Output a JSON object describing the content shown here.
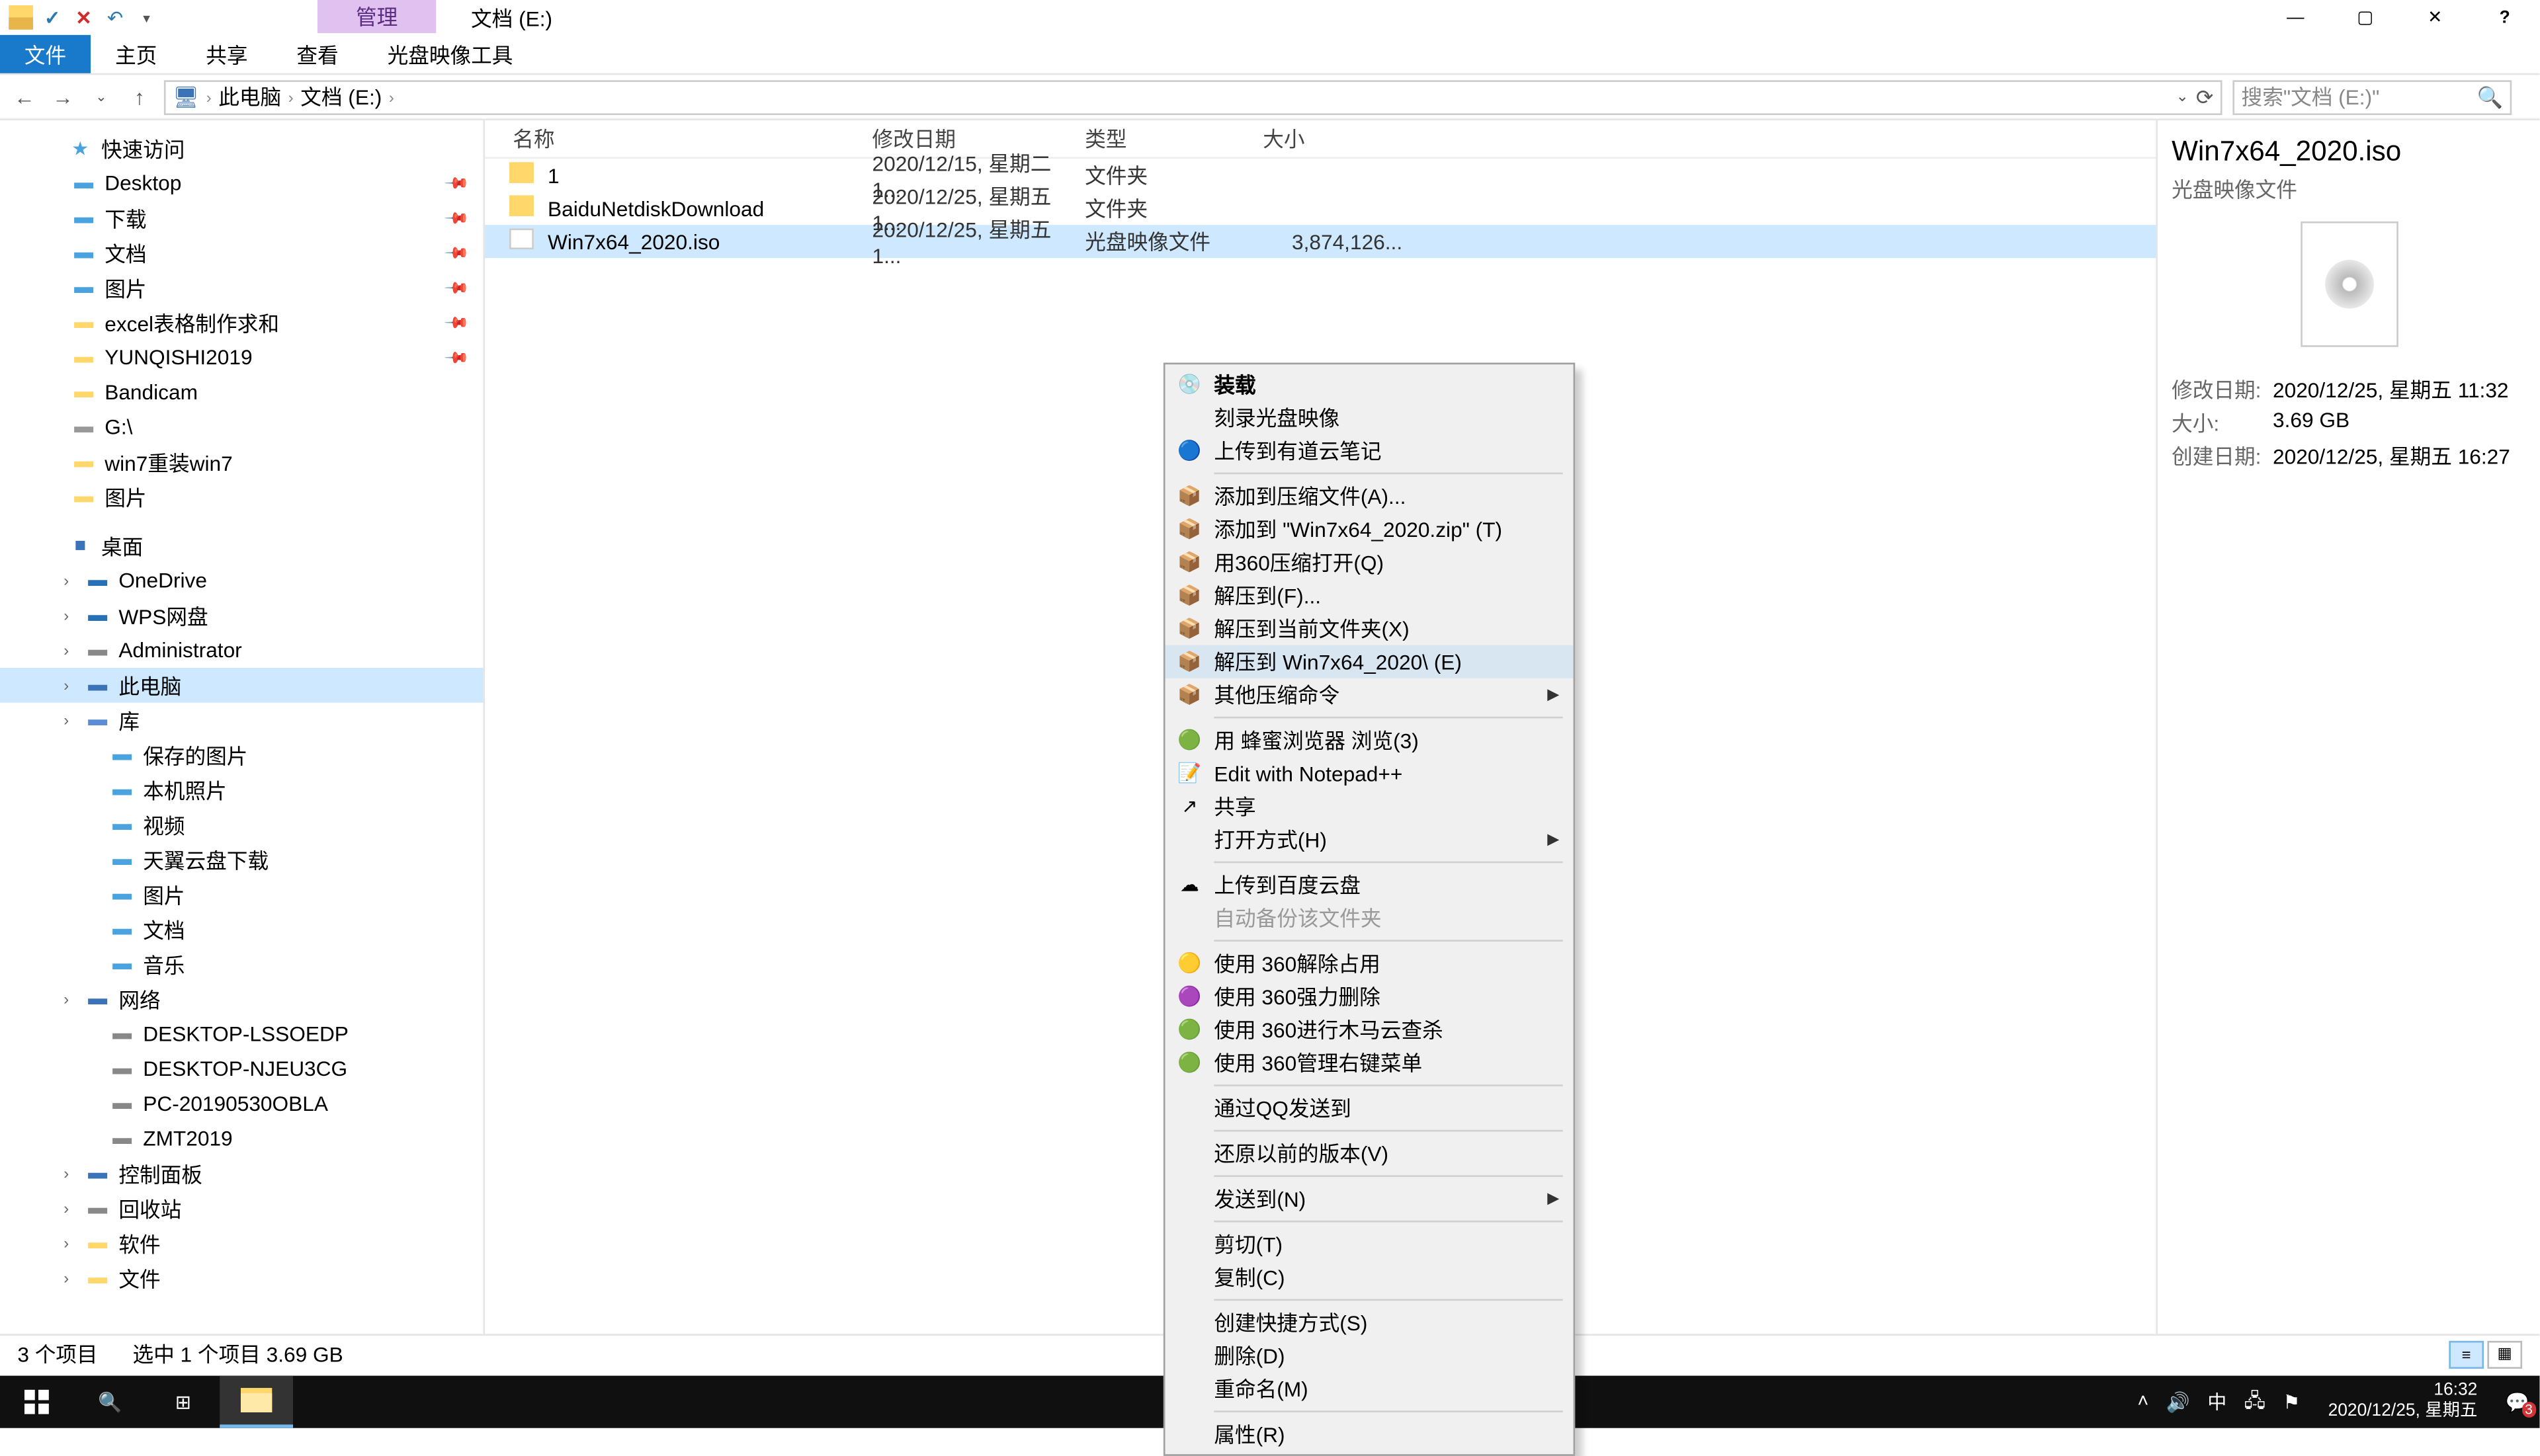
{
  "window": {
    "title": "文档 (E:)",
    "contextual_tab": "管理",
    "ribbon_tabs": [
      "文件",
      "主页",
      "共享",
      "查看",
      "光盘映像工具"
    ],
    "active_tab": 0
  },
  "navbuttons": {
    "back": "←",
    "fwd": "→",
    "up": "↑"
  },
  "breadcrumb": [
    "此电脑",
    "文档 (E:)"
  ],
  "search": {
    "placeholder": "搜索\"文档 (E:)\""
  },
  "nav": {
    "quick": {
      "label": "快速访问",
      "items": [
        {
          "label": "Desktop",
          "pin": true,
          "color": "#4aa3df"
        },
        {
          "label": "下载",
          "pin": true,
          "color": "#4aa3df"
        },
        {
          "label": "文档",
          "pin": true,
          "color": "#4aa3df"
        },
        {
          "label": "图片",
          "pin": true,
          "color": "#4aa3df"
        },
        {
          "label": "excel表格制作求和",
          "pin": true,
          "color": "#ffd76a"
        },
        {
          "label": "YUNQISHI2019",
          "pin": true,
          "color": "#ffd76a"
        },
        {
          "label": "Bandicam",
          "pin": false,
          "color": "#ffd76a"
        },
        {
          "label": "G:\\",
          "pin": false,
          "color": "#999"
        },
        {
          "label": "win7重装win7",
          "pin": false,
          "color": "#ffd76a"
        },
        {
          "label": "图片",
          "pin": false,
          "color": "#ffd76a"
        }
      ]
    },
    "desktop": {
      "label": "桌面",
      "items": [
        {
          "label": "OneDrive",
          "color": "#2670b8"
        },
        {
          "label": "WPS网盘",
          "color": "#2670b8"
        },
        {
          "label": "Administrator",
          "color": "#888"
        },
        {
          "label": "此电脑",
          "color": "#3b73b9",
          "selected": true
        },
        {
          "label": "库",
          "color": "#5b8dd6"
        },
        {
          "label": "保存的图片",
          "color": "#4aa3df",
          "indent": true
        },
        {
          "label": "本机照片",
          "color": "#4aa3df",
          "indent": true
        },
        {
          "label": "视频",
          "color": "#4aa3df",
          "indent": true
        },
        {
          "label": "天翼云盘下载",
          "color": "#4aa3df",
          "indent": true
        },
        {
          "label": "图片",
          "color": "#4aa3df",
          "indent": true
        },
        {
          "label": "文档",
          "color": "#4aa3df",
          "indent": true
        },
        {
          "label": "音乐",
          "color": "#4aa3df",
          "indent": true
        },
        {
          "label": "网络",
          "color": "#3b73b9"
        },
        {
          "label": "DESKTOP-LSSOEDP",
          "color": "#888",
          "indent": true
        },
        {
          "label": "DESKTOP-NJEU3CG",
          "color": "#888",
          "indent": true
        },
        {
          "label": "PC-20190530OBLA",
          "color": "#888",
          "indent": true
        },
        {
          "label": "ZMT2019",
          "color": "#888",
          "indent": true
        },
        {
          "label": "控制面板",
          "color": "#3b73b9"
        },
        {
          "label": "回收站",
          "color": "#888"
        },
        {
          "label": "软件",
          "color": "#ffd76a"
        },
        {
          "label": "文件",
          "color": "#ffd76a"
        }
      ]
    }
  },
  "columns": {
    "name": "名称",
    "date": "修改日期",
    "type": "类型",
    "size": "大小"
  },
  "rows": [
    {
      "name": "1",
      "date": "2020/12/15, 星期二 1...",
      "type": "文件夹",
      "size": "",
      "icon": "folder"
    },
    {
      "name": "BaiduNetdiskDownload",
      "date": "2020/12/25, 星期五 1...",
      "type": "文件夹",
      "size": "",
      "icon": "folder"
    },
    {
      "name": "Win7x64_2020.iso",
      "date": "2020/12/25, 星期五 1...",
      "type": "光盘映像文件",
      "size": "3,874,126...",
      "icon": "iso",
      "selected": true
    }
  ],
  "details": {
    "title": "Win7x64_2020.iso",
    "subtitle": "光盘映像文件",
    "modified_k": "修改日期:",
    "modified_v": "2020/12/25, 星期五 11:32",
    "size_k": "大小:",
    "size_v": "3.69 GB",
    "created_k": "创建日期:",
    "created_v": "2020/12/25, 星期五 16:27"
  },
  "context_menu": [
    {
      "label": "装载",
      "bold": true,
      "icon": "disc"
    },
    {
      "label": "刻录光盘映像"
    },
    {
      "label": "上传到有道云笔记",
      "icon": "blue"
    },
    {
      "sep": true
    },
    {
      "label": "添加到压缩文件(A)...",
      "icon": "zip"
    },
    {
      "label": "添加到 \"Win7x64_2020.zip\" (T)",
      "icon": "zip"
    },
    {
      "label": "用360压缩打开(Q)",
      "icon": "zip"
    },
    {
      "label": "解压到(F)...",
      "icon": "zip"
    },
    {
      "label": "解压到当前文件夹(X)",
      "icon": "zip"
    },
    {
      "label": "解压到 Win7x64_2020\\ (E)",
      "icon": "zip",
      "hover": true
    },
    {
      "label": "其他压缩命令",
      "icon": "zip",
      "sub": true
    },
    {
      "sep": true
    },
    {
      "label": "用 蜂蜜浏览器 浏览(3)",
      "icon": "green"
    },
    {
      "label": "Edit with Notepad++",
      "icon": "npp"
    },
    {
      "label": "共享",
      "icon": "share"
    },
    {
      "label": "打开方式(H)",
      "sub": true
    },
    {
      "sep": true
    },
    {
      "label": "上传到百度云盘",
      "icon": "baidu"
    },
    {
      "label": "自动备份该文件夹",
      "disabled": true
    },
    {
      "sep": true
    },
    {
      "label": "使用 360解除占用",
      "icon": "360y"
    },
    {
      "label": "使用 360强力删除",
      "icon": "360p"
    },
    {
      "label": "使用 360进行木马云查杀",
      "icon": "360g"
    },
    {
      "label": "使用 360管理右键菜单",
      "icon": "360g"
    },
    {
      "sep": true
    },
    {
      "label": "通过QQ发送到"
    },
    {
      "sep": true
    },
    {
      "label": "还原以前的版本(V)"
    },
    {
      "sep": true
    },
    {
      "label": "发送到(N)",
      "sub": true
    },
    {
      "sep": true
    },
    {
      "label": "剪切(T)"
    },
    {
      "label": "复制(C)"
    },
    {
      "sep": true
    },
    {
      "label": "创建快捷方式(S)"
    },
    {
      "label": "删除(D)"
    },
    {
      "label": "重命名(M)"
    },
    {
      "sep": true
    },
    {
      "label": "属性(R)"
    }
  ],
  "status": {
    "count": "3 个项目",
    "sel": "选中 1 个项目  3.69 GB"
  },
  "taskbar": {
    "time": "16:32",
    "date": "2020/12/25, 星期五",
    "ime": "中",
    "notif": "3"
  }
}
